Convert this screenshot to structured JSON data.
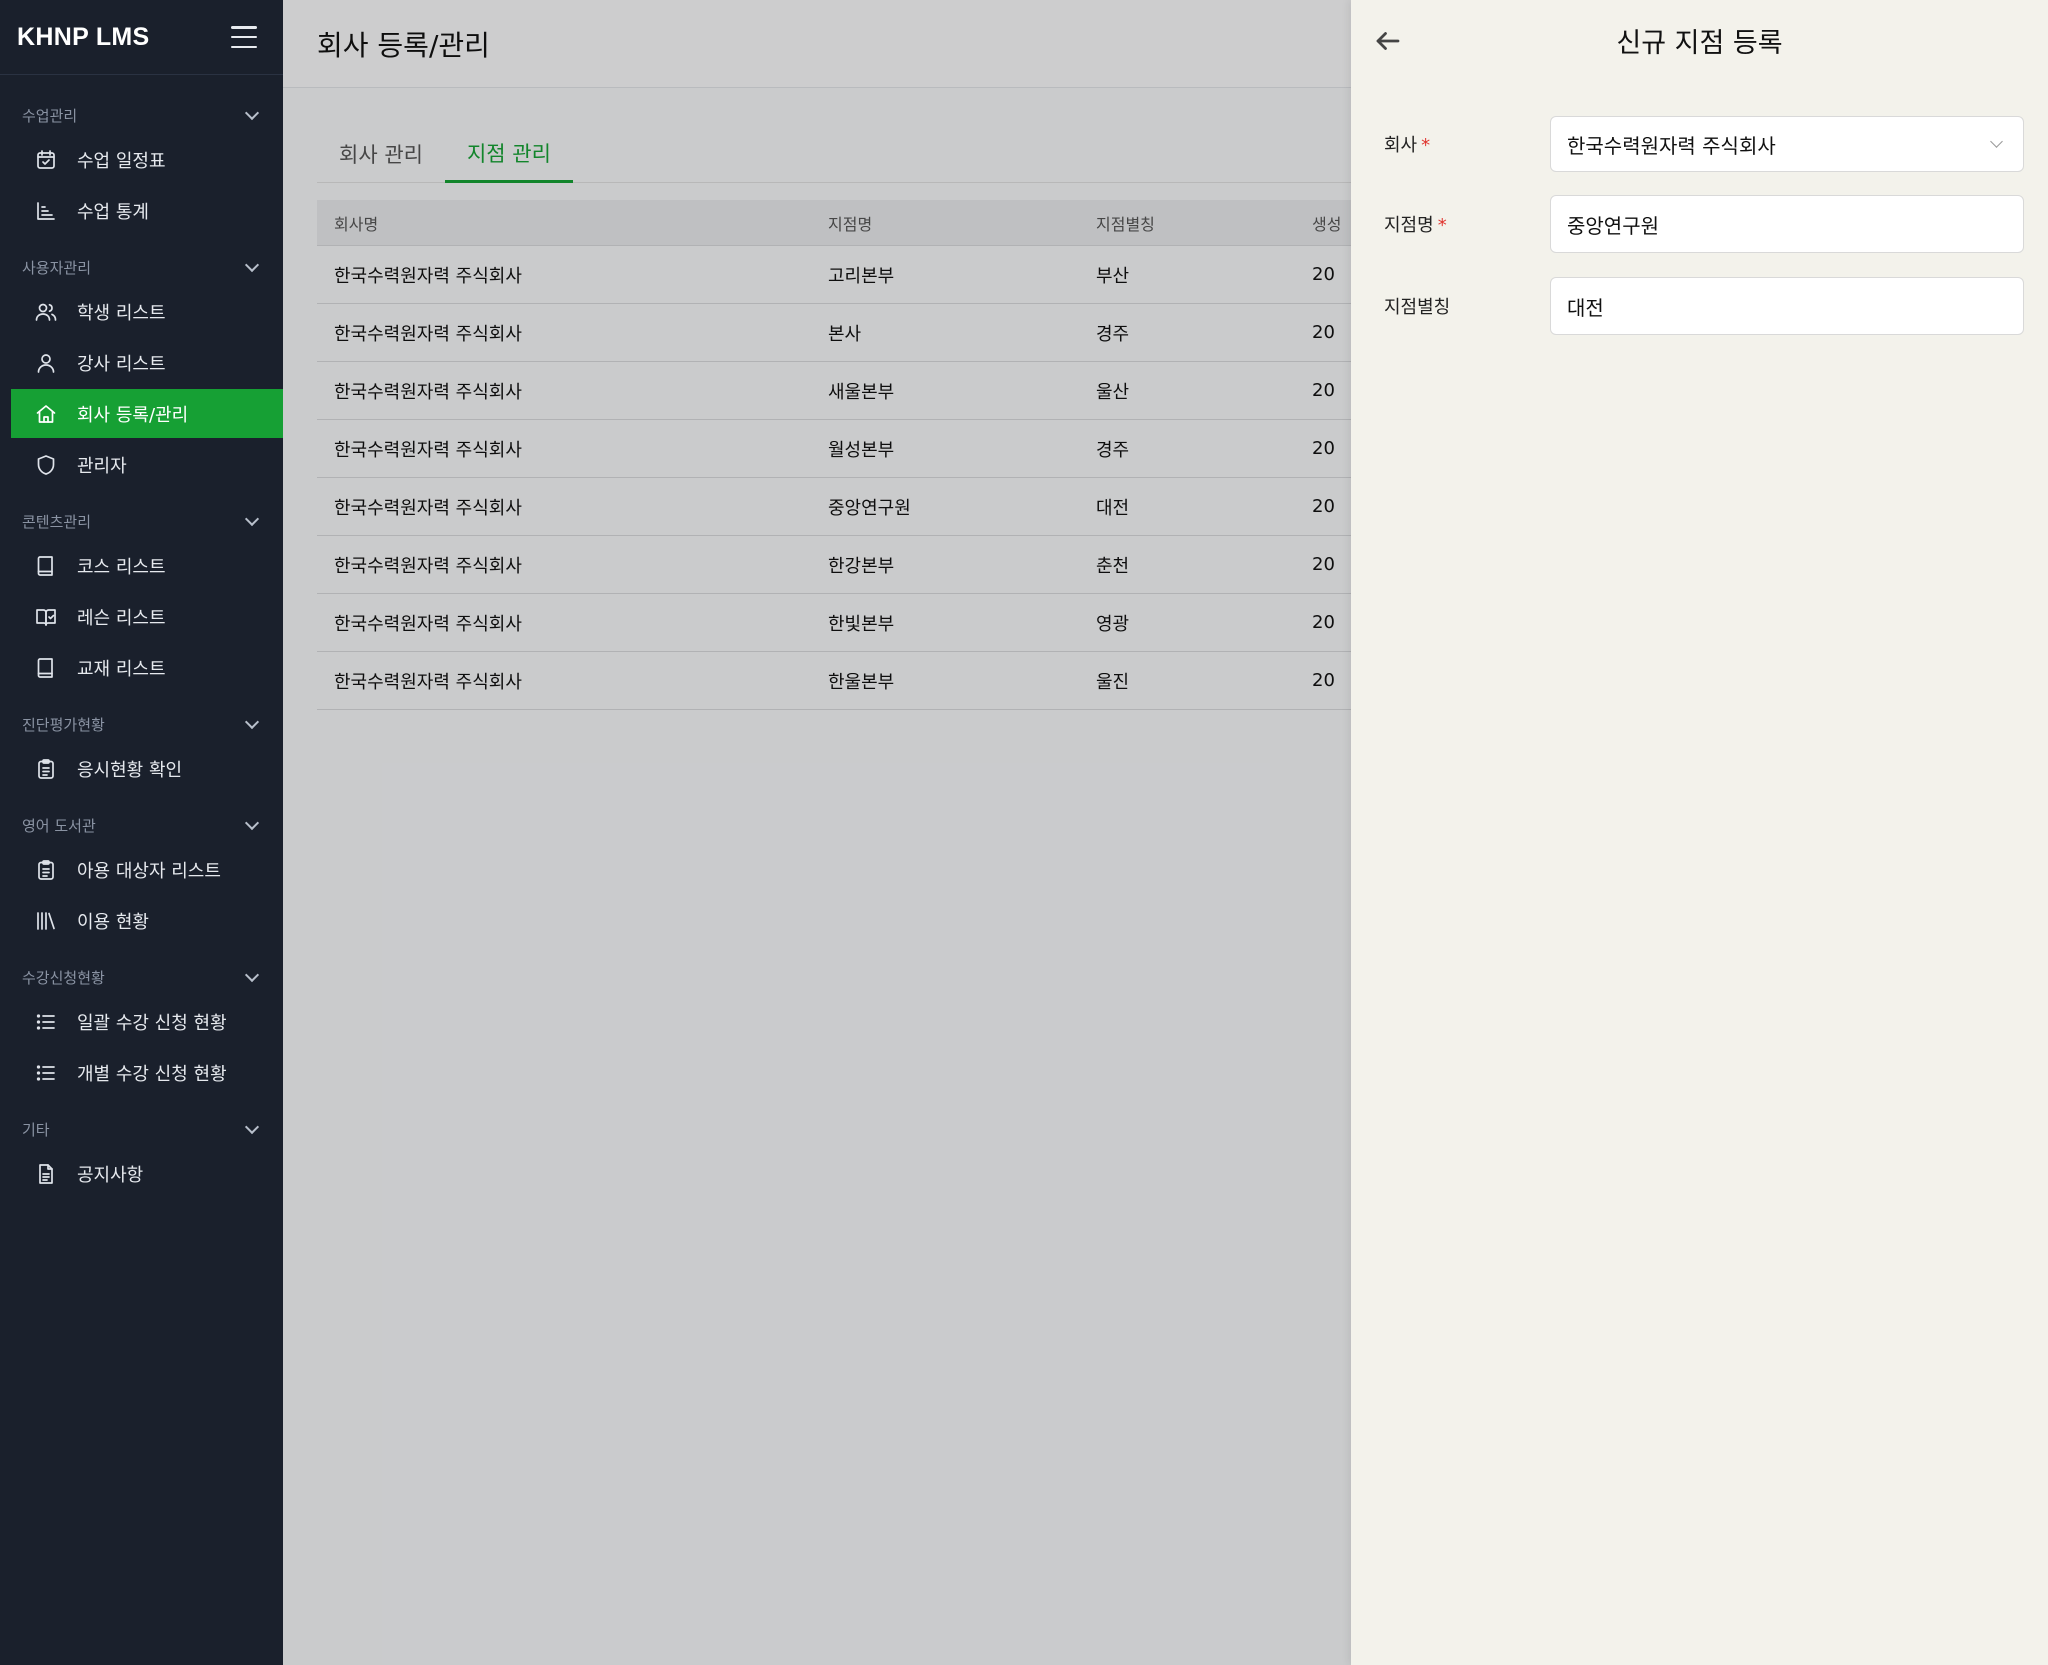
{
  "app": {
    "brand": "KHNP LMS"
  },
  "sidebar": {
    "groups": [
      {
        "title": "수업관리",
        "items": [
          {
            "label": "수업 일정표",
            "icon": "calendar-check-icon"
          },
          {
            "label": "수업 통계",
            "icon": "chart-icon"
          }
        ]
      },
      {
        "title": "사용자관리",
        "items": [
          {
            "label": "학생 리스트",
            "icon": "users-icon"
          },
          {
            "label": "강사 리스트",
            "icon": "user-icon"
          },
          {
            "label": "회사 등록/관리",
            "icon": "home-icon",
            "active": true
          },
          {
            "label": "관리자",
            "icon": "shield-icon"
          }
        ]
      },
      {
        "title": "콘텐츠관리",
        "items": [
          {
            "label": "코스 리스트",
            "icon": "book-icon"
          },
          {
            "label": "레슨 리스트",
            "icon": "book-open-icon"
          },
          {
            "label": "교재 리스트",
            "icon": "book-icon"
          }
        ]
      },
      {
        "title": "진단평가현황",
        "items": [
          {
            "label": "응시현황 확인",
            "icon": "clipboard-icon"
          }
        ]
      },
      {
        "title": "영어 도서관",
        "items": [
          {
            "label": "아용 대상자 리스트",
            "icon": "clipboard-icon"
          },
          {
            "label": "이용 현황",
            "icon": "library-icon"
          }
        ]
      },
      {
        "title": "수강신청현황",
        "items": [
          {
            "label": "일괄 수강 신청 현황",
            "icon": "list-icon"
          },
          {
            "label": "개별 수강 신청 현황",
            "icon": "list-icon"
          }
        ]
      },
      {
        "title": "기타",
        "items": [
          {
            "label": "공지사항",
            "icon": "document-icon"
          }
        ]
      }
    ]
  },
  "main": {
    "title": "회사 등록/관리",
    "tabs": [
      {
        "label": "회사 관리",
        "active": false
      },
      {
        "label": "지점 관리",
        "active": true
      }
    ],
    "table": {
      "headers": [
        "회사명",
        "지점명",
        "지점별칭",
        "생성"
      ],
      "rows": [
        [
          "한국수력원자력 주식회사",
          "고리본부",
          "부산",
          "20"
        ],
        [
          "한국수력원자력 주식회사",
          "본사",
          "경주",
          "20"
        ],
        [
          "한국수력원자력 주식회사",
          "새울본부",
          "울산",
          "20"
        ],
        [
          "한국수력원자력 주식회사",
          "월성본부",
          "경주",
          "20"
        ],
        [
          "한국수력원자력 주식회사",
          "중앙연구원",
          "대전",
          "20"
        ],
        [
          "한국수력원자력 주식회사",
          "한강본부",
          "춘천",
          "20"
        ],
        [
          "한국수력원자력 주식회사",
          "한빛본부",
          "영광",
          "20"
        ],
        [
          "한국수력원자력 주식회사",
          "한울본부",
          "울진",
          "20"
        ]
      ]
    }
  },
  "drawer": {
    "title": "신규 지점 등록",
    "required_mark": "*",
    "fields": {
      "company": {
        "label": "회사",
        "value": "한국수력원자력 주식회사"
      },
      "branch_name": {
        "label": "지점명",
        "value": "중앙연구원"
      },
      "branch_alias": {
        "label": "지점별칭",
        "value": "대전"
      }
    }
  },
  "colors": {
    "sidebar_bg": "#1a202c",
    "accent": "#16a034",
    "drawer_bg": "#f3f2eb",
    "required": "#e0342e"
  }
}
